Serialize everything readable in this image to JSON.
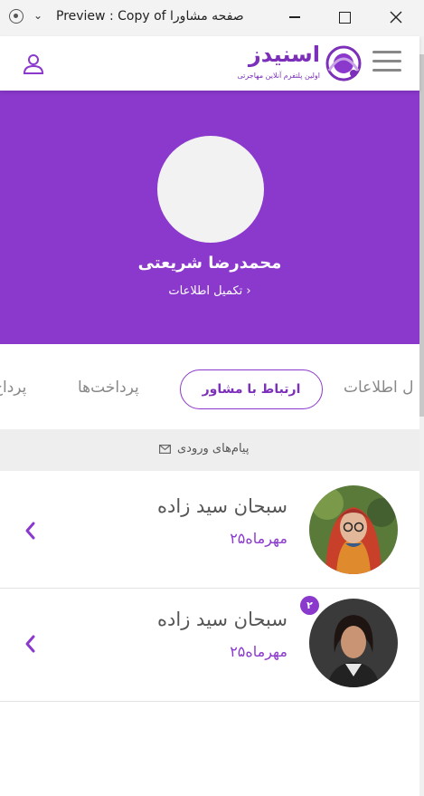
{
  "window": {
    "title": "Preview : Copy of صفحه مشاورا"
  },
  "header": {
    "logo_word": "اسنیدز",
    "logo_tagline": "اولین پلتفرم آنلاین مهاجرتی"
  },
  "profile": {
    "name": "محمدرضا شریعتی",
    "complete_link": "تکمیل اطلاعات ›"
  },
  "tabs": {
    "left_partial": "پرداخ",
    "payments": "پرداخت‌ها",
    "active": "ارتباط با مشاور",
    "right_partial": "ل اطلاعات"
  },
  "inbox": {
    "label": "پیام‌های ورودی"
  },
  "messages": [
    {
      "name": "سبحان سید زاده",
      "date": "۲۵مهرماه",
      "badge": ""
    },
    {
      "name": "سبحان سید زاده",
      "date": "۲۵مهرماه",
      "badge": "۲"
    }
  ],
  "colors": {
    "brand": "#8b39cc",
    "brand_dark": "#7c2fb8"
  }
}
